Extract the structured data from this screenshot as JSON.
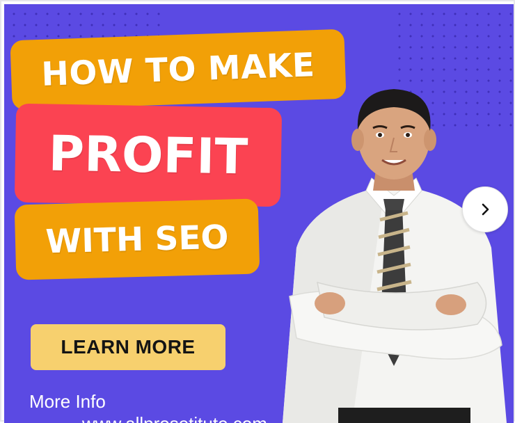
{
  "banner": {
    "headline_line1": "HOW TO MAKE",
    "headline_line2": "PROFIT",
    "headline_line3": "WITH SEO",
    "cta_label": "LEARN MORE",
    "more_info": "More Info",
    "cut_off_text": "…www.allprosetitute.com"
  },
  "carousel": {
    "next_icon": "chevron-right-icon"
  },
  "colors": {
    "background": "#5b4ae3",
    "orange": "#f2a007",
    "red": "#fb4352",
    "cta": "#f7d06e"
  }
}
